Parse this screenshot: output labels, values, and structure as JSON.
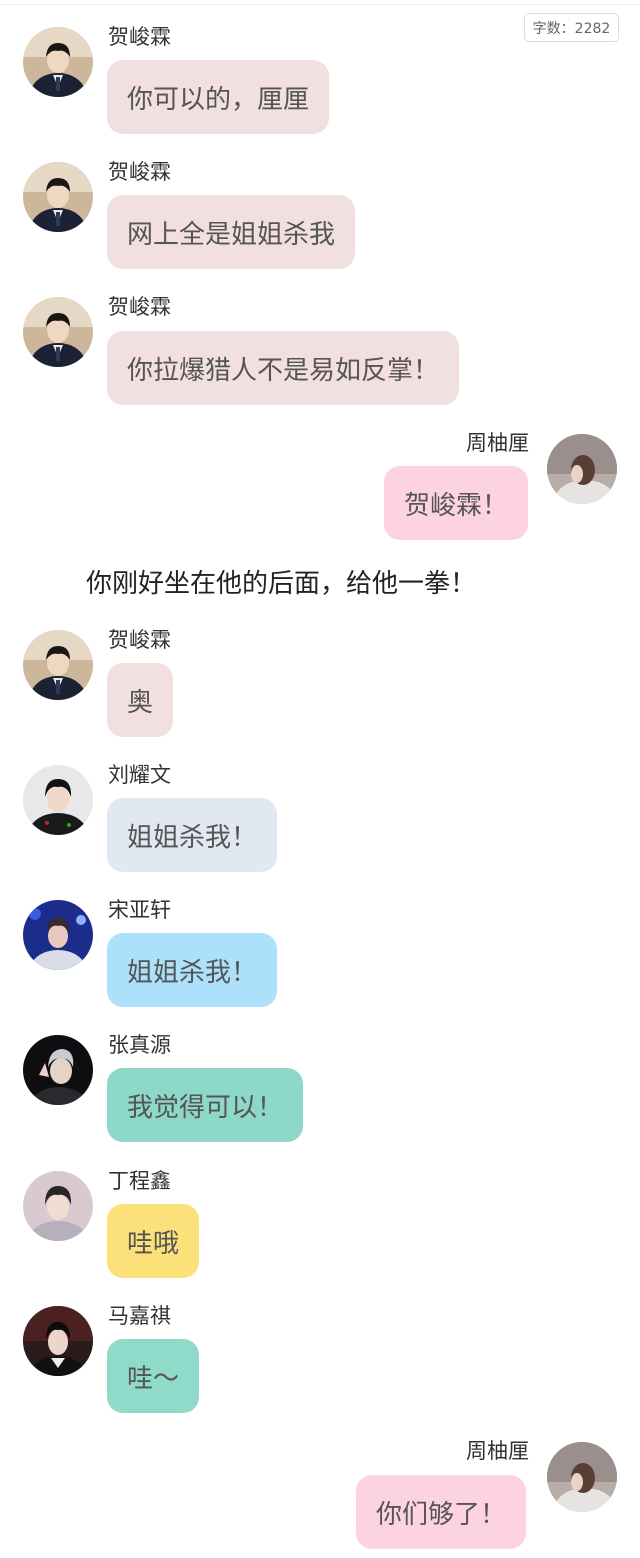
{
  "header": {
    "word_count": "字数：2282"
  },
  "colors": {
    "he": "#f2dfe0",
    "me": "#fdd3df",
    "liu": "#e1e8f2",
    "song": "#ace0fb",
    "zhang": "#8ed8c9",
    "ding": "#fce07a",
    "ma": "#8fdac9"
  },
  "messages": [
    {
      "side": "left",
      "speaker": "贺峻霖",
      "text": "你可以的，厘厘",
      "avatar": "portrait-icon-he"
    },
    {
      "side": "left",
      "speaker": "贺峻霖",
      "text": "网上全是姐姐杀我",
      "avatar": "portrait-icon-he"
    },
    {
      "side": "left",
      "speaker": "贺峻霖",
      "text": "你拉爆猎人不是易如反掌！",
      "avatar": "portrait-icon-he"
    },
    {
      "side": "right",
      "speaker": "周柚厘",
      "text": "贺峻霖！",
      "avatar": "portrait-icon-zhou"
    },
    {
      "side": "left",
      "speaker": "贺峻霖",
      "text": "奥",
      "avatar": "portrait-icon-he"
    },
    {
      "side": "left",
      "speaker": "刘耀文",
      "text": "姐姐杀我！",
      "avatar": "portrait-icon-liu"
    },
    {
      "side": "left",
      "speaker": "宋亚轩",
      "text": "姐姐杀我！",
      "avatar": "portrait-icon-song"
    },
    {
      "side": "left",
      "speaker": "张真源",
      "text": "我觉得可以！",
      "avatar": "portrait-icon-zhang"
    },
    {
      "side": "left",
      "speaker": "丁程鑫",
      "text": "哇哦",
      "avatar": "portrait-icon-ding"
    },
    {
      "side": "left",
      "speaker": "马嘉祺",
      "text": "哇～",
      "avatar": "portrait-icon-ma"
    },
    {
      "side": "right",
      "speaker": "周柚厘",
      "text": "你们够了！",
      "avatar": "portrait-icon-zhou"
    }
  ],
  "narration": "你刚好坐在他的后面，给他一拳！"
}
